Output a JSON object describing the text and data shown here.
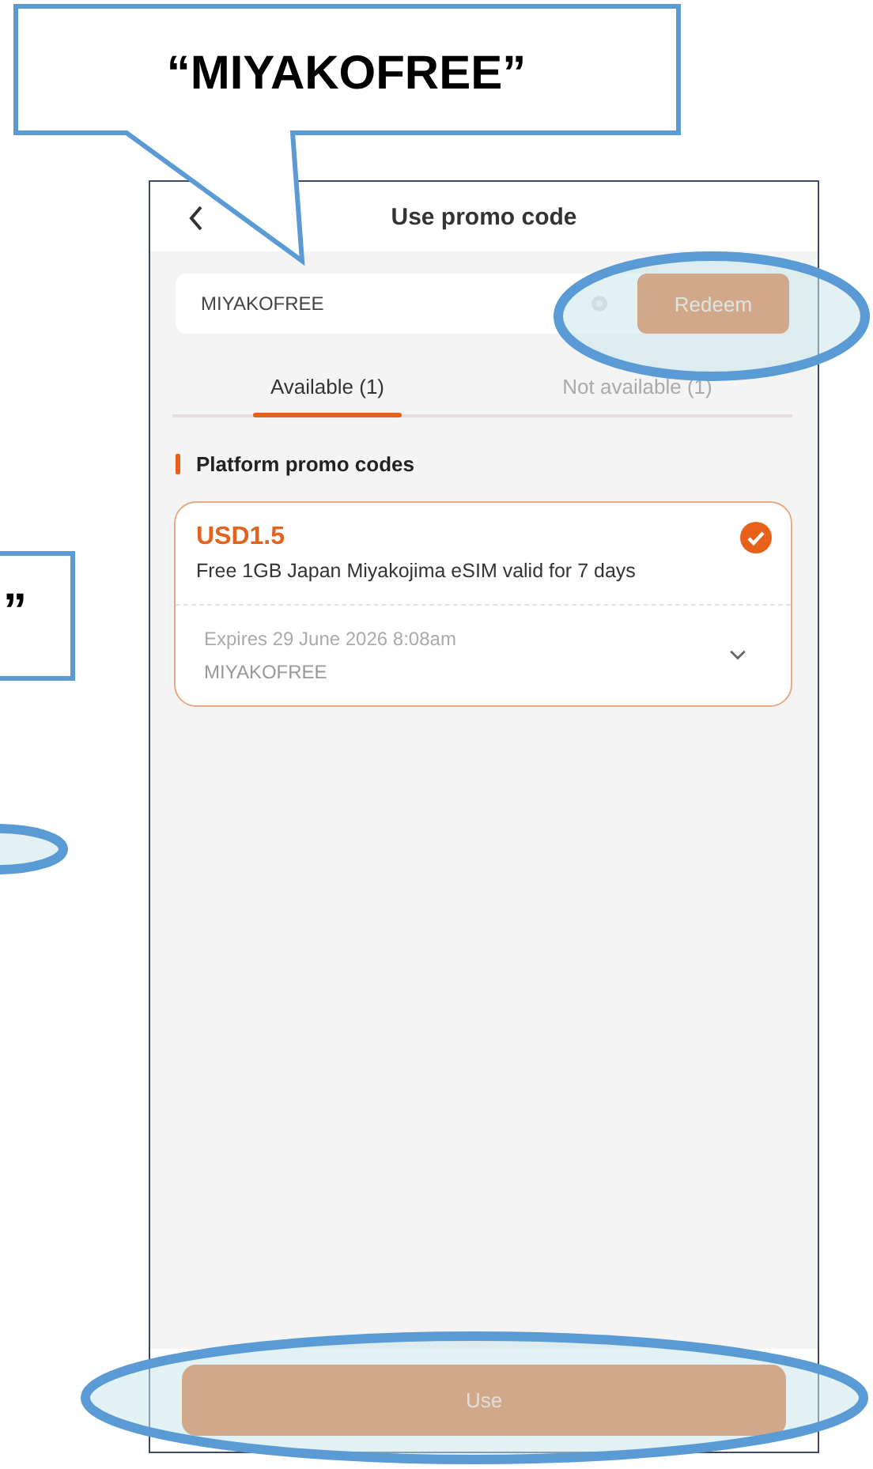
{
  "callouts": [
    {
      "text": "“MIYAKOFREE”"
    },
    {
      "text": "”"
    }
  ],
  "header": {
    "title": "Use promo code"
  },
  "promo_field": {
    "value": "MIYAKOFREE"
  },
  "redeem_button": "Redeem",
  "tabs": [
    {
      "label": "Available (1)",
      "selected": true
    },
    {
      "label": "Not available (1)",
      "selected": false
    }
  ],
  "section_title": "Platform promo codes",
  "coupons": [
    {
      "amount": "USD1.5",
      "description": "Free 1GB Japan Miyakojima eSIM valid for 7 days",
      "expires": "Expires 29 June 2026 8:08am",
      "code": "MIYAKOFREE",
      "selected": true
    }
  ],
  "use_button": "Use"
}
